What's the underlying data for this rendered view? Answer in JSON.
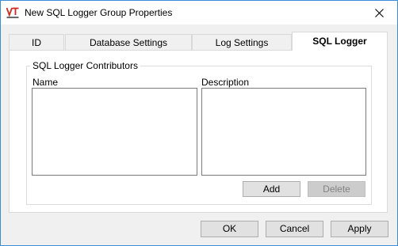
{
  "window": {
    "title": "New SQL Logger Group Properties",
    "app_icon": "vt-logo-icon",
    "close_icon": "close-icon"
  },
  "tabs": [
    {
      "label": "ID",
      "active": false
    },
    {
      "label": "Database Settings",
      "active": false
    },
    {
      "label": "Log Settings",
      "active": false
    },
    {
      "label": "SQL Logger",
      "active": true
    }
  ],
  "contributors": {
    "group_label": "SQL Logger Contributors",
    "name_label": "Name",
    "description_label": "Description",
    "add_label": "Add",
    "delete_label": "Delete"
  },
  "footer": {
    "ok_label": "OK",
    "cancel_label": "Cancel",
    "apply_label": "Apply"
  },
  "colors": {
    "accent_border": "#3c8ed8",
    "logo_red": "#d0271d",
    "dialog_bg": "#f0f0f0",
    "disabled_text": "#838383"
  }
}
